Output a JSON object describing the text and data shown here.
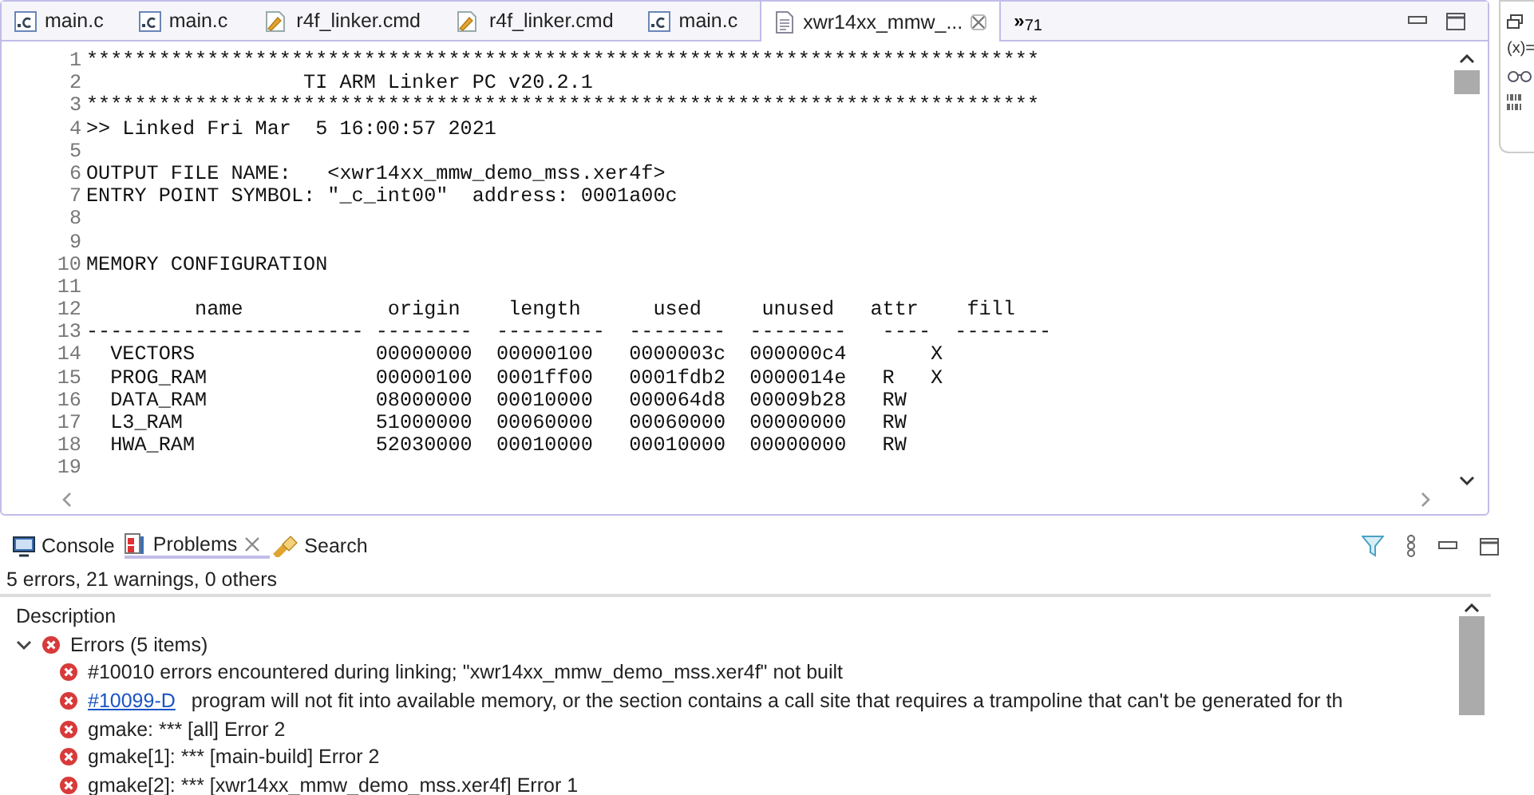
{
  "editor_tabs": [
    {
      "label": "main.c",
      "kind": "c",
      "selected": false
    },
    {
      "label": "main.c",
      "kind": "c",
      "selected": false
    },
    {
      "label": "r4f_linker.cmd",
      "kind": "cmd",
      "selected": false
    },
    {
      "label": "r4f_linker.cmd",
      "kind": "cmd",
      "selected": false
    },
    {
      "label": "main.c",
      "kind": "c",
      "selected": false
    },
    {
      "label": "xwr14xx_mmw_...",
      "kind": "text",
      "selected": true
    }
  ],
  "overflow_tabs": {
    "symbol": "»",
    "count": "71"
  },
  "editor": {
    "lines": [
      {
        "number": "1",
        "text": "*******************************************************************************"
      },
      {
        "number": "2",
        "text": "                  TI ARM Linker PC v20.2.1"
      },
      {
        "number": "3",
        "text": "*******************************************************************************"
      },
      {
        "number": "4",
        "text": ">> Linked Fri Mar  5 16:00:57 2021"
      },
      {
        "number": "5"
      },
      {
        "number": "6",
        "text": "OUTPUT FILE NAME:   <xwr14xx_mmw_demo_mss.xer4f>"
      },
      {
        "number": "7",
        "text": "ENTRY POINT SYMBOL: \"_c_int00\"  address: 0001a00c"
      },
      {
        "number": "8"
      },
      {
        "number": "9"
      },
      {
        "number": "10",
        "text": "MEMORY CONFIGURATION"
      },
      {
        "number": "11"
      },
      {
        "number": "12",
        "text": "         name            origin    length      used     unused   attr    fill"
      },
      {
        "number": "13",
        "text": "----------------------- --------  ---------  --------  --------   ----  --------"
      },
      {
        "number": "14",
        "text": "  VECTORS               00000000  00000100   0000003c  000000c4       X"
      },
      {
        "number": "15",
        "text": "  PROG_RAM              00000100  0001ff00   0001fdb2  0000014e   R   X"
      },
      {
        "number": "16",
        "text": "  DATA_RAM              08000000  00010000   000064d8  00009b28   RW"
      },
      {
        "number": "17",
        "text": "  L3_RAM                51000000  00060000   00060000  00000000   RW"
      },
      {
        "number": "18",
        "text": "  HWA_RAM               52030000  00010000   00010000  00000000   RW"
      },
      {
        "number": "19"
      }
    ]
  },
  "side_toolbar": [
    {
      "kind": "restore"
    },
    {
      "kind": "text",
      "label": "(x)="
    },
    {
      "kind": "glasses"
    },
    {
      "kind": "binary"
    }
  ],
  "bottom_panel": {
    "tabs": [
      {
        "label": "Console",
        "kind": "console",
        "selected": false
      },
      {
        "label": "Problems",
        "kind": "problems",
        "selected": true
      },
      {
        "label": "Search",
        "kind": "search",
        "selected": false
      }
    ],
    "summary": "5 errors, 21 warnings, 0 others",
    "columns": [
      "Description"
    ],
    "tree": [
      {
        "label": "Errors (5 items)",
        "kind": "error",
        "expanded": true,
        "children": [
          {
            "kind": "error",
            "text": "#10010 errors encountered during linking; \"xwr14xx_mmw_demo_mss.xer4f\" not built"
          },
          {
            "kind": "error",
            "link": "#10099-D",
            "text": "program will not fit into available memory, or the section contains a call site that requires a trampoline that can't be generated for th"
          },
          {
            "kind": "error",
            "text": "gmake: *** [all] Error 2"
          },
          {
            "kind": "error",
            "text": "gmake[1]: *** [main-build] Error 2"
          },
          {
            "kind": "error",
            "text": "gmake[2]: *** [xwr14xx_mmw_demo_mss.xer4f] Error 1"
          }
        ]
      }
    ]
  }
}
